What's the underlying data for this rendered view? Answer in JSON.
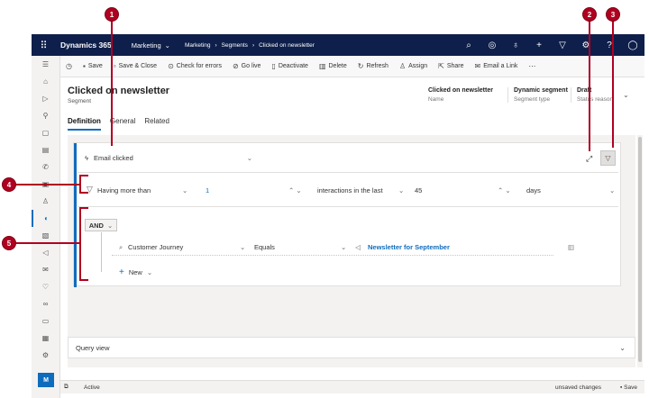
{
  "topbar": {
    "brand": "Dynamics 365",
    "app": "Marketing",
    "crumbs": [
      "Marketing",
      "Segments",
      "Clicked on newsletter"
    ]
  },
  "commands": [
    {
      "icon": "save-icon",
      "label": "Save"
    },
    {
      "icon": "save-close-icon",
      "label": "Save & Close"
    },
    {
      "icon": "check-errors-icon",
      "label": "Check for errors"
    },
    {
      "icon": "go-live-icon",
      "label": "Go live"
    },
    {
      "icon": "deactivate-icon",
      "label": "Deactivate"
    },
    {
      "icon": "delete-icon",
      "label": "Delete"
    },
    {
      "icon": "refresh-icon",
      "label": "Refresh"
    },
    {
      "icon": "assign-icon",
      "label": "Assign"
    },
    {
      "icon": "share-icon",
      "label": "Share"
    },
    {
      "icon": "email-link-icon",
      "label": "Email a Link"
    }
  ],
  "header": {
    "title": "Clicked on newsletter",
    "subtitle": "Segment",
    "fields": [
      {
        "value": "Clicked on newsletter",
        "label": "Name"
      },
      {
        "value": "Dynamic segment",
        "label": "Segment type"
      },
      {
        "value": "Draft",
        "label": "Status reason"
      }
    ]
  },
  "tabs": [
    "Definition",
    "General",
    "Related"
  ],
  "definition": {
    "interaction": "Email clicked",
    "condition": "Having more than",
    "count": "1",
    "window_label": "interactions in the last",
    "window_value": "45",
    "unit": "days",
    "operator": "AND",
    "rule": {
      "field": "Customer Journey",
      "op": "Equals",
      "value": "Newsletter for September"
    },
    "new_label": "New"
  },
  "query_view": "Query view",
  "status": {
    "state": "Active",
    "unsaved": "unsaved changes",
    "save": "Save"
  },
  "callouts": [
    "1",
    "2",
    "3",
    "4",
    "5"
  ],
  "colors": {
    "accent": "#0f6cbd",
    "navy": "#0f1f4b",
    "callout": "#b00020"
  }
}
